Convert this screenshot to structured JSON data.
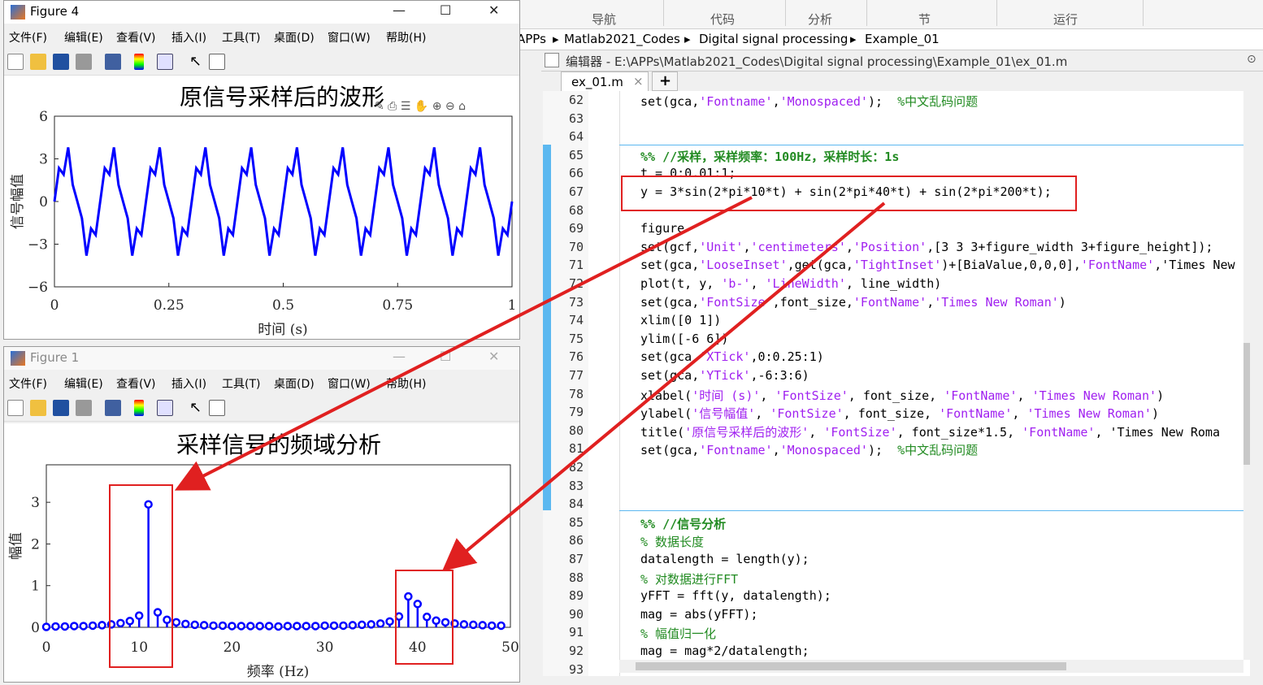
{
  "ribbon": {
    "tabs": [
      "导航",
      "代码",
      "分析",
      "节",
      "运行"
    ]
  },
  "address": {
    "items": [
      "APPs",
      "Matlab2021_Codes",
      "Digital signal processing",
      "Example_01"
    ]
  },
  "editor": {
    "title": "编辑器 - E:\\APPs\\Matlab2021_Codes\\Digital signal processing\\Example_01\\ex_01.m",
    "tab": "ex_01.m",
    "add_tab": "+",
    "lines": [
      {
        "n": "62",
        "t": "set(gca,'Fontname','Monospaced');  %中文乱码问题"
      },
      {
        "n": "63",
        "t": ""
      },
      {
        "n": "64",
        "t": ""
      },
      {
        "n": "65",
        "t": "%% //采样，采样频率：100Hz，采样时长：1s"
      },
      {
        "n": "66",
        "t": "t = 0:0.01:1;"
      },
      {
        "n": "67",
        "t": "y = 3*sin(2*pi*10*t) + sin(2*pi*40*t) + sin(2*pi*200*t);"
      },
      {
        "n": "68",
        "t": ""
      },
      {
        "n": "69",
        "t": "figure"
      },
      {
        "n": "70",
        "t": "set(gcf,'Unit','centimeters','Position',[3 3 3+figure_width 3+figure_height]);"
      },
      {
        "n": "71",
        "t": "set(gca,'LooseInset',get(gca,'TightInset')+[BiaValue,0,0,0],'FontName','Times New"
      },
      {
        "n": "72",
        "t": "plot(t, y, 'b-', 'LineWidth', line_width)"
      },
      {
        "n": "73",
        "t": "set(gca,'FontSize',font_size,'FontName','Times New Roman')"
      },
      {
        "n": "74",
        "t": "xlim([0 1])"
      },
      {
        "n": "75",
        "t": "ylim([-6 6])"
      },
      {
        "n": "76",
        "t": "set(gca,'XTick',0:0.25:1)"
      },
      {
        "n": "77",
        "t": "set(gca,'YTick',-6:3:6)"
      },
      {
        "n": "78",
        "t": "xlabel('时间 (s)', 'FontSize', font_size, 'FontName', 'Times New Roman')"
      },
      {
        "n": "79",
        "t": "ylabel('信号幅值', 'FontSize', font_size, 'FontName', 'Times New Roman')"
      },
      {
        "n": "80",
        "t": "title('原信号采样后的波形', 'FontSize', font_size*1.5, 'FontName', 'Times New Roma"
      },
      {
        "n": "81",
        "t": "set(gca,'Fontname','Monospaced');  %中文乱码问题"
      },
      {
        "n": "82",
        "t": ""
      },
      {
        "n": "83",
        "t": ""
      },
      {
        "n": "84",
        "t": ""
      },
      {
        "n": "85",
        "t": "%% //信号分析"
      },
      {
        "n": "86",
        "t": "% 数据长度"
      },
      {
        "n": "87",
        "t": "datalength = length(y);"
      },
      {
        "n": "88",
        "t": "% 对数据进行FFT"
      },
      {
        "n": "89",
        "t": "yFFT = fft(y, datalength);"
      },
      {
        "n": "90",
        "t": "mag = abs(yFFT);"
      },
      {
        "n": "91",
        "t": "% 幅值归一化"
      },
      {
        "n": "92",
        "t": "mag = mag*2/datalength;"
      },
      {
        "n": "93",
        "t": ""
      }
    ]
  },
  "menu": [
    "文件(F)",
    "编辑(E)",
    "查看(V)",
    "插入(I)",
    "工具(T)",
    "桌面(D)",
    "窗口(W)",
    "帮助(H)"
  ],
  "fig4": {
    "title": "Figure 4",
    "plot_title": "原信号采样后的波形",
    "xlabel": "时间 (s)",
    "ylabel": "信号幅值"
  },
  "fig1": {
    "title": "Figure 1",
    "plot_title": "采样信号的频域分析",
    "xlabel": "频率 (Hz)",
    "ylabel": "幅值"
  },
  "colors": {
    "series": "#0000ff",
    "annotation": "#e02020"
  },
  "chart_data": [
    {
      "type": "line",
      "title": "原信号采样后的波形",
      "xlabel": "时间 (s)",
      "ylabel": "信号幅值",
      "xlim": [
        0,
        1
      ],
      "ylim": [
        -6,
        6
      ],
      "xticks": [
        0,
        0.25,
        0.5,
        0.75,
        1
      ],
      "xticklabels": [
        "0",
        "0.25",
        "0.5",
        "0.75",
        "1"
      ],
      "yticks": [
        -6,
        -3,
        0,
        3,
        6
      ],
      "yticklabels": [
        "−6",
        "−3",
        "0",
        "3",
        "6"
      ],
      "formula": "y = 3*sin(2*pi*10*t) + sin(2*pi*40*t) + sin(2*pi*200*t)",
      "t_step": 0.01
    },
    {
      "type": "stem",
      "title": "采样信号的频域分析",
      "xlabel": "频率 (Hz)",
      "ylabel": "幅值",
      "xlim": [
        0,
        50
      ],
      "ylim": [
        0,
        3.9
      ],
      "xticks": [
        0,
        10,
        20,
        30,
        40,
        50
      ],
      "yticks": [
        0,
        1,
        2,
        3
      ],
      "x": [
        0,
        1,
        2,
        3,
        4,
        5,
        6,
        7,
        8,
        9,
        10,
        11,
        12,
        13,
        14,
        15,
        16,
        17,
        18,
        19,
        20,
        21,
        22,
        23,
        24,
        25,
        26,
        27,
        28,
        29,
        30,
        31,
        32,
        33,
        34,
        35,
        36,
        37,
        38,
        39,
        40,
        41,
        42,
        43,
        44,
        45,
        46,
        47,
        48,
        49
      ],
      "y": [
        0.01,
        0.02,
        0.02,
        0.03,
        0.03,
        0.04,
        0.05,
        0.07,
        0.1,
        0.15,
        0.28,
        2.95,
        0.36,
        0.18,
        0.12,
        0.08,
        0.06,
        0.05,
        0.04,
        0.04,
        0.03,
        0.03,
        0.03,
        0.03,
        0.03,
        0.02,
        0.03,
        0.03,
        0.03,
        0.03,
        0.04,
        0.04,
        0.04,
        0.05,
        0.06,
        0.07,
        0.09,
        0.14,
        0.26,
        0.74,
        0.56,
        0.25,
        0.16,
        0.12,
        0.09,
        0.07,
        0.06,
        0.05,
        0.04,
        0.04
      ]
    }
  ]
}
